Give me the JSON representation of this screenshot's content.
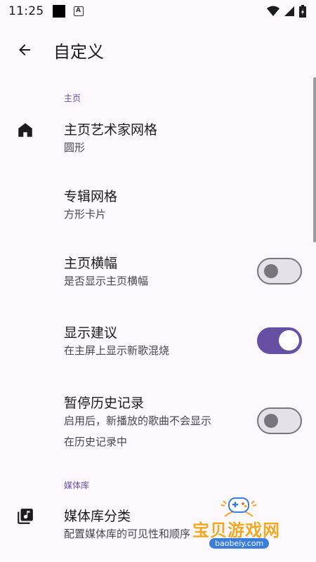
{
  "status_bar": {
    "time": "11:25"
  },
  "app_bar": {
    "title": "自定义"
  },
  "sections": {
    "home": {
      "header": "主页",
      "items": [
        {
          "title": "主页艺术家网格",
          "summary": "圆形"
        },
        {
          "title": "专辑网格",
          "summary": "方形卡片"
        },
        {
          "title": "主页横幅",
          "summary": "是否显示主页横幅",
          "switch": false
        },
        {
          "title": "显示建议",
          "summary": "在主屏上显示新歌混烧",
          "switch": true
        },
        {
          "title": "暂停历史记录",
          "summary_line1": "启用后，新播放的歌曲不会显示",
          "summary_line2": "在历史记录中",
          "switch": false
        }
      ]
    },
    "library": {
      "header": "媒体库",
      "items": [
        {
          "title": "媒体库分类",
          "summary": "配置媒体库的可见性和顺序"
        }
      ]
    }
  },
  "watermark": {
    "text": "宝贝游戏网",
    "url": "baobeiy.com"
  },
  "colors": {
    "accent": "#6750a4",
    "background": "#fdf7fe",
    "switch_off": "#79747e",
    "watermark": "#f5a623"
  }
}
